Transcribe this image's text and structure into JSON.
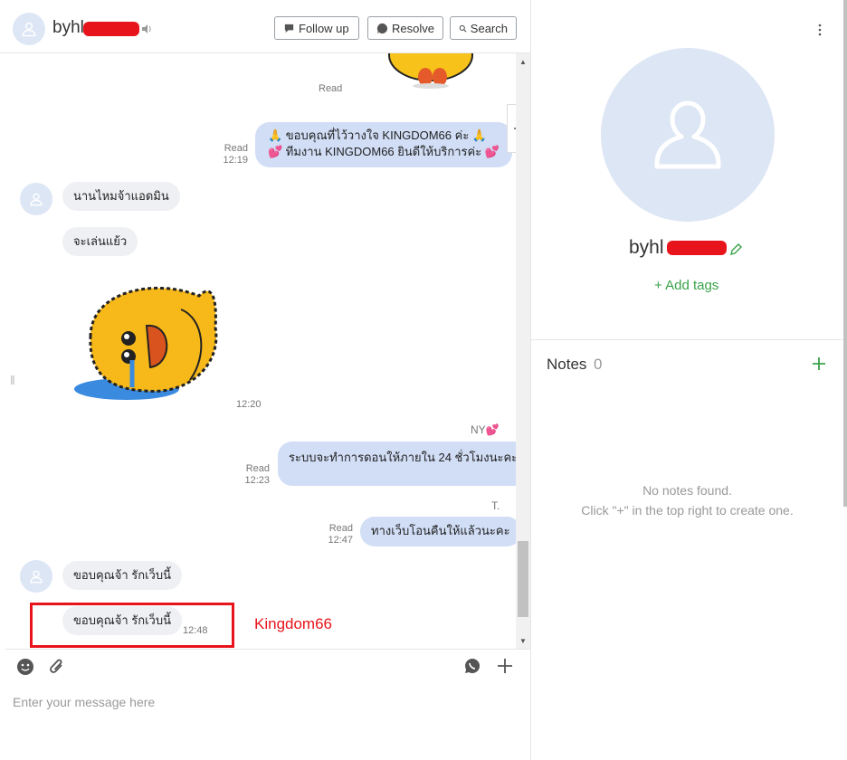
{
  "header": {
    "contact_name": "byhl",
    "buttons": {
      "follow_up": "Follow up",
      "resolve": "Resolve",
      "search": "Search"
    }
  },
  "messages": {
    "m1_meta": "Read",
    "m2_text_line1": "🙏 ขอบคุณที่ไว้วางใจ KINGDOM66 ค่ะ 🙏",
    "m2_text_line2": "💕 ทีมงาน KINGDOM66 ยินดีให้บริการค่ะ 💕",
    "m2_read": "Read",
    "m2_time": "12:19",
    "m3_text": "นานไหมจ้าแอดมิน",
    "m4_text": "จะเล่นแย้ว",
    "m5_time": "12:20",
    "m6_sender": "NY💕",
    "m6_text": "ระบบจะทำการดอนให้ภายใน 24 ชั่วโมงนะคะ",
    "m6_read": "Read",
    "m6_time": "12:23",
    "m7_sender": "T.",
    "m7_text": "ทางเว็บโอนคืนให้แล้วนะคะ",
    "m7_read": "Read",
    "m7_time": "12:47",
    "m8_text": "ขอบคุณจ้า รักเว็บนี้",
    "m9_text": "ขอบคุณจ้า รักเว็บนี้",
    "m9_time": "12:48"
  },
  "annotation": {
    "label": "Kingdom66",
    "color": "#e8141b"
  },
  "composer": {
    "placeholder": "Enter your message here"
  },
  "profile": {
    "name": "byhl",
    "add_tags": "+ Add tags"
  },
  "notes": {
    "title": "Notes",
    "count": "0",
    "empty_line1": "No notes found.",
    "empty_line2": "Click \"+\" in the top right to create one."
  },
  "colors": {
    "accent_green": "#3aa24a",
    "bubble_out": "#d1def6",
    "bubble_in": "#eef0f3",
    "avatar_bg": "#dde6f5"
  },
  "icons": [
    "user-icon",
    "speaker-icon",
    "follow-up-icon",
    "resolve-icon",
    "search-icon",
    "collapse-panel-icon",
    "emoji-icon",
    "attachment-icon",
    "whatsapp-icon",
    "plus-icon",
    "edit-icon",
    "more-icon"
  ]
}
